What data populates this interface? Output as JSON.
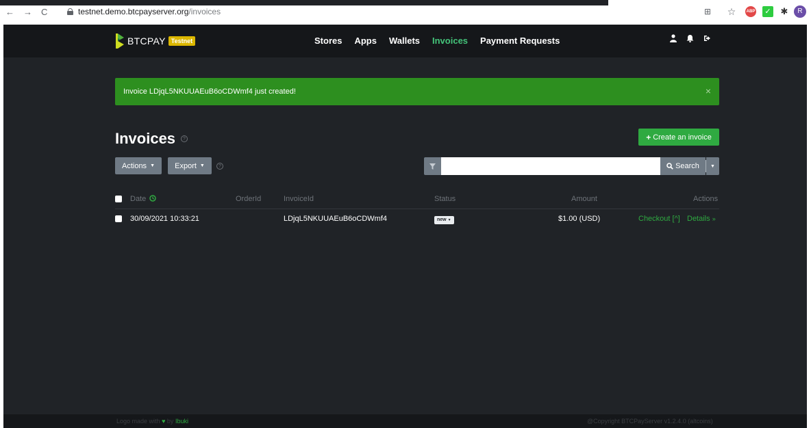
{
  "browser": {
    "url_host": "testnet.demo.btcpayserver.org",
    "url_path": "/invoices",
    "back": "←",
    "forward": "→",
    "reload": "C",
    "profile_initial": "R"
  },
  "brand": {
    "name": "BTCPAY",
    "badge": "Testnet",
    "accent": "#44c47a"
  },
  "nav": {
    "items": [
      {
        "label": "Stores",
        "active": false
      },
      {
        "label": "Apps",
        "active": false
      },
      {
        "label": "Wallets",
        "active": false
      },
      {
        "label": "Invoices",
        "active": true
      },
      {
        "label": "Payment Requests",
        "active": false
      }
    ]
  },
  "alert": {
    "message": "Invoice LDjqL5NKUUAEuB6oCDWmf4 just created!",
    "close": "×"
  },
  "page": {
    "title": "Invoices",
    "create_button": "Create an invoice",
    "actions_button": "Actions",
    "export_button": "Export",
    "search_button": "Search",
    "search_value": ""
  },
  "table": {
    "headers": {
      "date": "Date",
      "order_id": "OrderId",
      "invoice_id": "InvoiceId",
      "status": "Status",
      "amount": "Amount",
      "actions": "Actions"
    },
    "rows": [
      {
        "date": "30/09/2021 10:33:21",
        "order_id": "",
        "invoice_id": "LDjqL5NKUUAEuB6oCDWmf4",
        "status": "new",
        "amount": "$1.00 (USD)",
        "checkout": "Checkout [^]",
        "details": "Details"
      }
    ]
  },
  "footer": {
    "left_prefix": "Logo made with",
    "left_by": "by",
    "left_name": "Ibuki",
    "right": "@Copyright BTCPayServer v1.2.4.0 (altcoins)"
  }
}
